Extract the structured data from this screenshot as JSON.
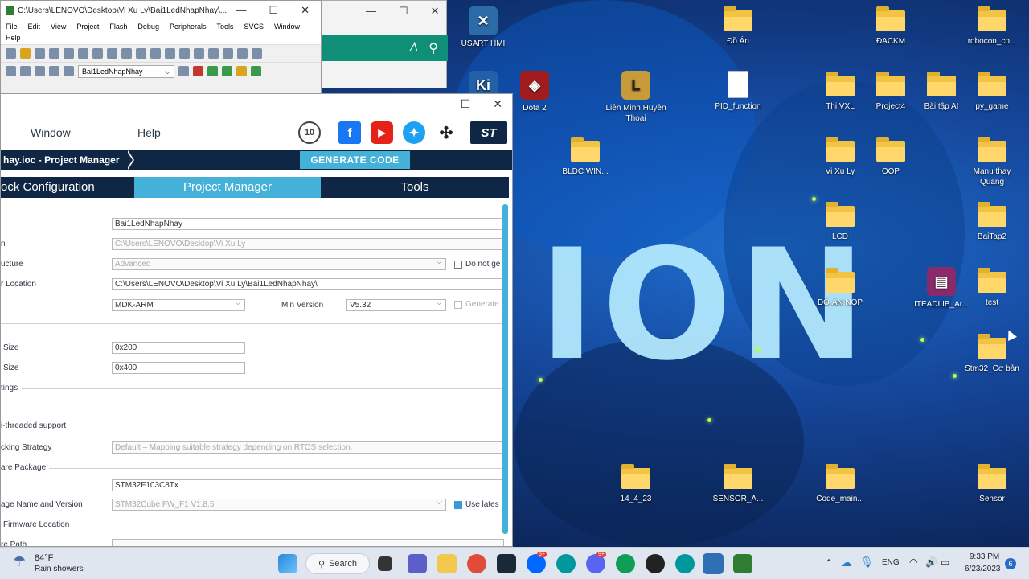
{
  "keil": {
    "title": "C:\\Users\\LENOVO\\Desktop\\Vi Xu Ly\\Bai1LedNhapNhay\\...",
    "menu": [
      "File",
      "Edit",
      "View",
      "Project",
      "Flash",
      "Debug",
      "Peripherals",
      "Tools",
      "SVCS",
      "Window",
      "Help"
    ],
    "target": "Bai1LedNhapNhay"
  },
  "cubemx": {
    "menu": {
      "window": "Window",
      "help": "Help"
    },
    "breadcrumb": "hay.ioc - Project Manager",
    "generate_label": "GENERATE CODE",
    "tabs": [
      "ock Configuration",
      "Project Manager",
      "Tools"
    ],
    "form": {
      "project_name": "Bai1LedNhapNhay",
      "project_location": "C:\\Users\\LENOVO\\Desktop\\Vi Xu Ly",
      "structure_label": "ucture",
      "structure_value": "Advanced",
      "do_not_gen_label": "Do not ge",
      "folder_location_label": "r Location",
      "folder_location": "C:\\Users\\LENOVO\\Desktop\\Vi Xu Ly\\Bai1LedNhapNhay\\",
      "toolchain": "MDK-ARM",
      "min_version_label": "Min Version",
      "min_version": "V5.32",
      "generate_label": "Generate",
      "heap_label": "Size",
      "heap_value": "0x200",
      "stack_label": "Size",
      "stack_value": "0x400",
      "settings_label": "tings",
      "multi_thread_label": "i-threaded support",
      "locking_label": "cking Strategy",
      "locking_value": "Default – Mapping suitable strategy depending on RTOS selection.",
      "fw_package_label": "are Package",
      "mcu": "STM32F103C8Tx",
      "pkg_name_label": "age Name and Version",
      "pkg_value": "STM32Cube FW_F1 V1.8.5",
      "use_latest_label": "Use lates",
      "fw_location_label": "Firmware Location",
      "repo_path_label": "re Path"
    }
  },
  "desktop_icons": [
    {
      "label": "USART HMI"
    },
    {
      "label": "Đồ Án"
    },
    {
      "label": "ĐACKM"
    },
    {
      "label": "robocon_co..."
    },
    {
      "label": "Dota 2"
    },
    {
      "label": "Liên Minh Huyền Thoại"
    },
    {
      "label": "PID_function"
    },
    {
      "label": "Thi VXL"
    },
    {
      "label": "Project4"
    },
    {
      "label": "Bài tập AI"
    },
    {
      "label": "py_game"
    },
    {
      "label": "BLDC WIN..."
    },
    {
      "label": "Vi Xu Ly"
    },
    {
      "label": "OOP"
    },
    {
      "label": "Manu thay Quang"
    },
    {
      "label": "LCD"
    },
    {
      "label": "BaiTap2"
    },
    {
      "label": "ĐỒ ÁN NỘP"
    },
    {
      "label": "ITEADLIB_Ar..."
    },
    {
      "label": "test"
    },
    {
      "label": "Stm32_Cơ bản"
    },
    {
      "label": "14_4_23"
    },
    {
      "label": "SENSOR_A..."
    },
    {
      "label": "Code_main..."
    },
    {
      "label": "Sensor"
    }
  ],
  "wallpaper_text": "ION",
  "taskbar": {
    "weather_temp": "84°F",
    "weather_desc": "Rain showers",
    "search_label": "Search",
    "language": "ENG",
    "time": "9:33 PM",
    "date": "6/23/2023",
    "notif_count": "6",
    "zalo_badge": "5+",
    "discord_badge": "9+"
  }
}
